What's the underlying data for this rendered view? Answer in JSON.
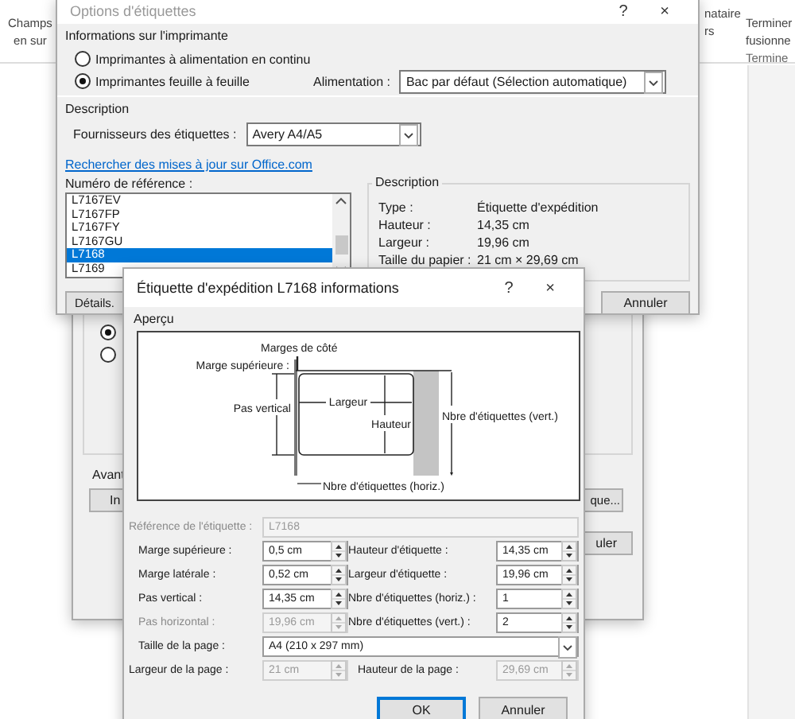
{
  "ribbon": {
    "groups": [
      [
        "Champs",
        "en sur"
      ],
      [
        "nataire",
        "rs"
      ],
      [
        "Terminer",
        "fusionne",
        "Termine"
      ]
    ]
  },
  "back_dialog": {
    "radios": [
      {
        "selected": true
      },
      {
        "selected": false
      }
    ],
    "note": "Avant",
    "buttons": [
      "In",
      "que...",
      "uler"
    ]
  },
  "options_dialog": {
    "title": "Options d'étiquettes",
    "help": "?",
    "close": "×",
    "printer_section": "Informations sur l'imprimante",
    "printer_types": [
      {
        "label": "Imprimantes à alimentation en continu",
        "selected": false
      },
      {
        "label": "Imprimantes feuille à feuille",
        "selected": true
      }
    ],
    "tray": {
      "label": "Alimentation :",
      "value": "Bac par défaut (Sélection automatique)"
    },
    "description_section": "Description",
    "vendor": {
      "label": "Fournisseurs des étiquettes :",
      "value": "Avery A4/A5"
    },
    "update_link": "Rechercher des mises à jour sur Office.com",
    "reference_label": "Numéro de référence :",
    "references": [
      {
        "label": "L7167EV",
        "selected": false
      },
      {
        "label": "L7167FP",
        "selected": false
      },
      {
        "label": "L7167FY",
        "selected": false
      },
      {
        "label": "L7167GU",
        "selected": false
      },
      {
        "label": "L7168",
        "selected": true
      },
      {
        "label": "L7169",
        "selected": false
      }
    ],
    "details": {
      "title": "Description",
      "rows": [
        {
          "label": "Type :",
          "value": "Étiquette d'expédition"
        },
        {
          "label": "Hauteur :",
          "value": "14,35 cm"
        },
        {
          "label": "Largeur :",
          "value": "19,96 cm"
        },
        {
          "label": "Taille du papier :",
          "value": "21 cm × 29,69 cm"
        }
      ]
    },
    "buttons": [
      "Détails.",
      "Annuler"
    ]
  },
  "info_dialog": {
    "title": "Étiquette d'expédition L7168 informations",
    "help": "?",
    "close": "×",
    "preview_label": "Aperçu",
    "diagram_labels": {
      "side_margin": "Marges de côté",
      "top_margin": "Marge supérieure :",
      "vertical_pitch": "Pas vertical",
      "width": "Largeur",
      "height": "Hauteur",
      "count_vert": "Nbre d'étiquettes (vert.)",
      "count_horiz": "Nbre d'étiquettes (horiz.)"
    },
    "fields": [
      {
        "kind": "readonly",
        "label": "Référence de l'étiquette :",
        "value": "L7168",
        "disabled": true,
        "label_dimmed": true
      },
      {
        "kind": "spin",
        "label": "Marge supérieure :",
        "value": "0,5 cm",
        "disabled": false,
        "label_dimmed": false
      },
      {
        "kind": "spin",
        "label": "Hauteur d'étiquette :",
        "value": "14,35 cm",
        "disabled": false,
        "label_dimmed": false
      },
      {
        "kind": "spin",
        "label": "Marge latérale :",
        "value": "0,52 cm",
        "disabled": false,
        "label_dimmed": false
      },
      {
        "kind": "spin",
        "label": "Largeur d'étiquette :",
        "value": "19,96 cm",
        "disabled": false,
        "label_dimmed": false
      },
      {
        "kind": "spin",
        "label": "Pas vertical :",
        "value": "14,35 cm",
        "disabled": false,
        "label_dimmed": false
      },
      {
        "kind": "spin",
        "label": "Nbre d'étiquettes (horiz.) :",
        "value": "1",
        "disabled": false,
        "label_dimmed": false
      },
      {
        "kind": "spin",
        "label": "Pas horizontal :",
        "value": "19,96 cm",
        "disabled": true,
        "label_dimmed": true
      },
      {
        "kind": "spin",
        "label": "Nbre d'étiquettes (vert.) :",
        "value": "2",
        "disabled": false,
        "label_dimmed": false
      },
      {
        "kind": "select",
        "label": "Taille de la page :",
        "value": "A4 (210 x 297 mm)",
        "disabled": false,
        "label_dimmed": false
      },
      {
        "kind": "spin",
        "label": "Largeur de la page :",
        "value": "21 cm",
        "disabled": true,
        "label_dimmed": false
      },
      {
        "kind": "spin",
        "label": "Hauteur de la page :",
        "value": "29,69 cm",
        "disabled": true,
        "label_dimmed": false
      }
    ],
    "buttons": [
      {
        "label": "OK",
        "default": true
      },
      {
        "label": "Annuler",
        "default": false
      }
    ]
  }
}
